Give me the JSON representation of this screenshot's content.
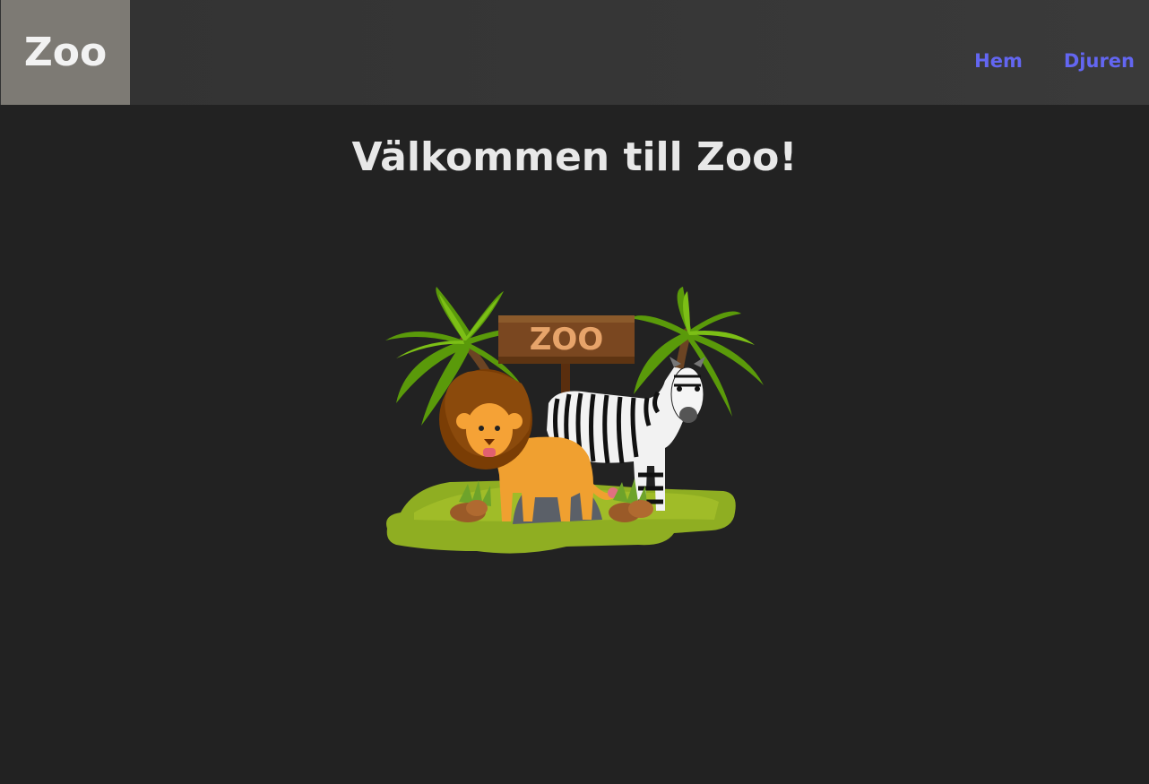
{
  "header": {
    "logo_text": "Zoo",
    "nav": [
      {
        "label": "Hem"
      },
      {
        "label": "Djuren"
      }
    ],
    "nav_color": "#6366f1"
  },
  "main": {
    "title": "Välkommen till Zoo!",
    "hero_image": {
      "icon": "zoo-illustration",
      "sign_text": "ZOO"
    }
  }
}
